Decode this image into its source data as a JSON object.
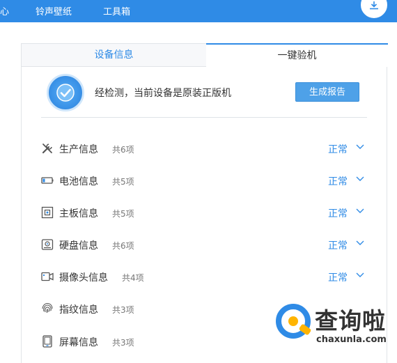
{
  "topbar": {
    "nav_items": [
      "心",
      "铃声壁纸",
      "工具箱"
    ],
    "download_icon": "download-icon",
    "accent_color": "#2f8be6"
  },
  "tabs": [
    {
      "label": "设备信息",
      "active": false
    },
    {
      "label": "一键验机",
      "active": true
    }
  ],
  "status": {
    "icon": "check-circle-icon",
    "text": "经检测，当前设备是原装正版机",
    "button_label": "生成报告"
  },
  "rows": [
    {
      "icon": "tools-icon",
      "label": "生产信息",
      "count": "共6项",
      "status": "正常"
    },
    {
      "icon": "battery-icon",
      "label": "电池信息",
      "count": "共5项",
      "status": "正常"
    },
    {
      "icon": "mainboard-icon",
      "label": "主板信息",
      "count": "共5项",
      "status": "正常"
    },
    {
      "icon": "disk-icon",
      "label": "硬盘信息",
      "count": "共6项",
      "status": "正常"
    },
    {
      "icon": "camera-icon",
      "label": "摄像头信息",
      "count": "共4项",
      "status": "正常"
    },
    {
      "icon": "fingerprint-icon",
      "label": "指纹信息",
      "count": "共3项",
      "status": ""
    },
    {
      "icon": "screen-icon",
      "label": "屏幕信息",
      "count": "共3项",
      "status": ""
    }
  ],
  "watermark": {
    "title": "查询啦",
    "url": "chaxunla.com"
  }
}
